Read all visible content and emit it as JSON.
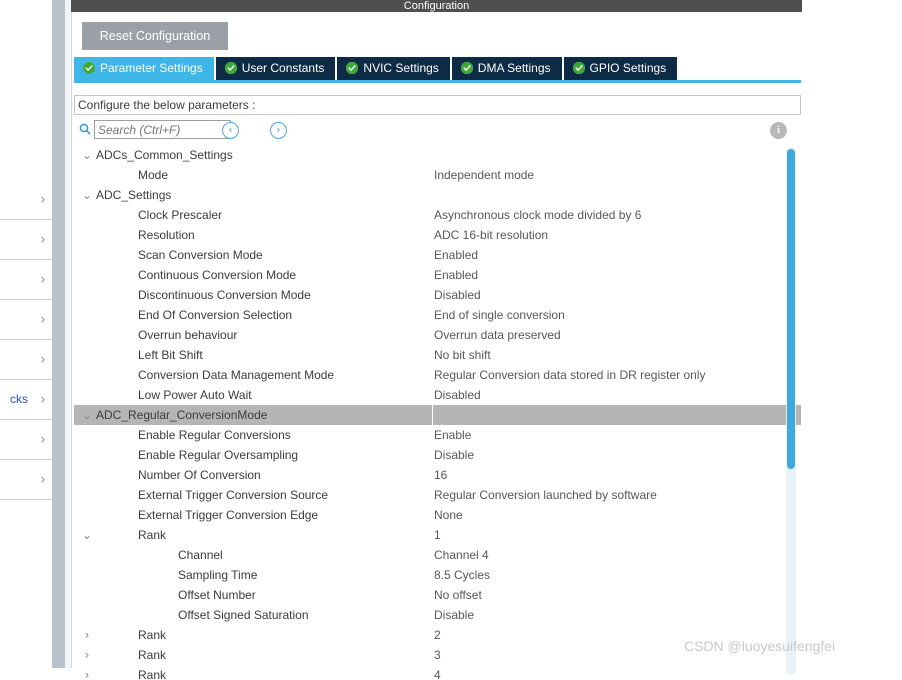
{
  "window": {
    "title": "Configuration"
  },
  "toolbar": {
    "reset_label": "Reset Configuration"
  },
  "tabs": [
    {
      "label": "Parameter Settings",
      "icon": "check-circle-icon",
      "active": true
    },
    {
      "label": "User Constants",
      "icon": "check-circle-icon",
      "active": false
    },
    {
      "label": "NVIC Settings",
      "icon": "check-circle-icon",
      "active": false
    },
    {
      "label": "DMA Settings",
      "icon": "check-circle-icon",
      "active": false
    },
    {
      "label": "GPIO Settings",
      "icon": "check-circle-icon",
      "active": false
    }
  ],
  "instruction": {
    "text": "Configure the below parameters :"
  },
  "search": {
    "placeholder": "Search (Ctrl+F)",
    "value": "",
    "icon": "search-icon",
    "prev_label": "‹",
    "next_label": "›",
    "info_label": "i"
  },
  "tree": {
    "rows": [
      {
        "level": 0,
        "twisty": "⌄",
        "name": "ADCs_Common_Settings",
        "value": "",
        "group": false
      },
      {
        "level": 1,
        "twisty": "",
        "name": "Mode",
        "value": "Independent mode",
        "group": false
      },
      {
        "level": 0,
        "twisty": "⌄",
        "name": "ADC_Settings",
        "value": "",
        "group": false
      },
      {
        "level": 1,
        "twisty": "",
        "name": "Clock Prescaler",
        "value": "Asynchronous clock mode divided by 6",
        "group": false
      },
      {
        "level": 1,
        "twisty": "",
        "name": "Resolution",
        "value": "ADC 16-bit resolution",
        "group": false
      },
      {
        "level": 1,
        "twisty": "",
        "name": "Scan Conversion Mode",
        "value": "Enabled",
        "group": false
      },
      {
        "level": 1,
        "twisty": "",
        "name": "Continuous Conversion Mode",
        "value": "Enabled",
        "group": false
      },
      {
        "level": 1,
        "twisty": "",
        "name": "Discontinuous Conversion Mode",
        "value": "Disabled",
        "group": false
      },
      {
        "level": 1,
        "twisty": "",
        "name": "End Of Conversion Selection",
        "value": "End of single conversion",
        "group": false
      },
      {
        "level": 1,
        "twisty": "",
        "name": "Overrun behaviour",
        "value": "Overrun data preserved",
        "group": false
      },
      {
        "level": 1,
        "twisty": "",
        "name": "Left Bit Shift",
        "value": "No bit shift",
        "group": false
      },
      {
        "level": 1,
        "twisty": "",
        "name": "Conversion Data Management Mode",
        "value": "Regular Conversion data stored in DR register only",
        "group": false
      },
      {
        "level": 1,
        "twisty": "",
        "name": "Low Power Auto Wait",
        "value": "Disabled",
        "group": false
      },
      {
        "level": 0,
        "twisty": "⌄",
        "name": "ADC_Regular_ConversionMode",
        "value": "",
        "group": true
      },
      {
        "level": 1,
        "twisty": "",
        "name": "Enable Regular Conversions",
        "value": "Enable",
        "group": false
      },
      {
        "level": 1,
        "twisty": "",
        "name": "Enable Regular Oversampling",
        "value": "Disable",
        "group": false
      },
      {
        "level": 1,
        "twisty": "",
        "name": "Number Of Conversion",
        "value": "16",
        "group": false
      },
      {
        "level": 1,
        "twisty": "",
        "name": "External Trigger Conversion Source",
        "value": "Regular Conversion launched by software",
        "group": false
      },
      {
        "level": 1,
        "twisty": "",
        "name": "External Trigger Conversion Edge",
        "value": "None",
        "group": false
      },
      {
        "level": 1,
        "twisty": "⌄",
        "name": "Rank",
        "value": "1",
        "group": false
      },
      {
        "level": 2,
        "twisty": "",
        "name": "Channel",
        "value": "Channel 4",
        "group": false
      },
      {
        "level": 2,
        "twisty": "",
        "name": "Sampling Time",
        "value": "8.5 Cycles",
        "group": false
      },
      {
        "level": 2,
        "twisty": "",
        "name": "Offset Number",
        "value": "No offset",
        "group": false
      },
      {
        "level": 2,
        "twisty": "",
        "name": "Offset Signed Saturation",
        "value": "Disable",
        "group": false
      },
      {
        "level": 1,
        "twisty": "›",
        "name": "Rank",
        "value": "2",
        "group": false
      },
      {
        "level": 1,
        "twisty": "›",
        "name": "Rank",
        "value": "3",
        "group": false
      },
      {
        "level": 1,
        "twisty": "›",
        "name": "Rank",
        "value": "4",
        "group": false
      }
    ]
  },
  "sidebar": {
    "items": [
      {
        "label": "",
        "chevron": "›"
      },
      {
        "label": "",
        "chevron": "›"
      },
      {
        "label": "",
        "chevron": "›"
      },
      {
        "label": "",
        "chevron": "›"
      },
      {
        "label": "",
        "chevron": "›"
      },
      {
        "label": "cks",
        "chevron": "›"
      },
      {
        "label": "",
        "chevron": "›"
      },
      {
        "label": "",
        "chevron": "›"
      }
    ]
  },
  "watermark": {
    "text": "CSDN @luoyesuifengfei"
  },
  "colors": {
    "accent": "#3fb6e8",
    "tab_inactive": "#0d2b45",
    "group_row": "#b5b5b5",
    "title_bar": "#4f4f4f",
    "scrollbar": "#41a8dd"
  }
}
